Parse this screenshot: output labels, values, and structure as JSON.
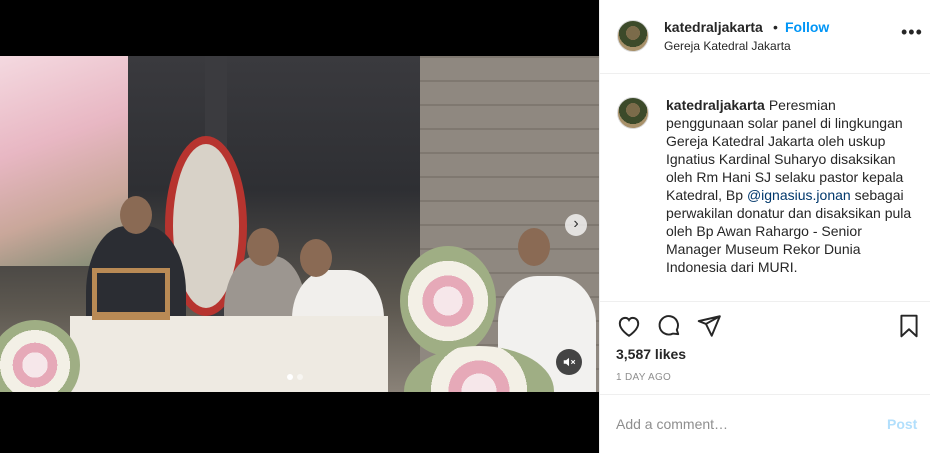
{
  "post": {
    "username": "katedraljakarta",
    "follow_label": "Follow",
    "separator": "•",
    "location": "Gereja Katedral Jakarta",
    "more_label": "•••"
  },
  "caption": {
    "username": "katedraljakarta",
    "text_before": "Peresmian penggunaan solar panel di lingkungan Gereja Katedral Jakarta oleh uskup Ignatius Kardinal Suharyo disaksikan oleh Rm Hani SJ selaku pastor kepala Katedral, Bp",
    "mention": "@ignasius.jonan",
    "text_after": "sebagai perwakilan donatur dan disaksikan pula oleh Bp Awan Rahargo - Senior Manager Museum Rekor Dunia Indonesia dari MURI."
  },
  "stats": {
    "likes": "3,587 likes",
    "time": "1 DAY AGO"
  },
  "comment": {
    "placeholder": "Add a comment…",
    "post_label": "Post"
  },
  "media": {
    "next_arrow": "›",
    "carousel_total": 2,
    "carousel_active": 1
  },
  "icons": {
    "like": "heart-icon",
    "comment": "comment-icon",
    "share": "share-icon",
    "save": "bookmark-icon",
    "mute": "speaker-muted-icon",
    "more": "more-options-icon",
    "next": "chevron-right-icon"
  },
  "colors": {
    "link_blue": "#0095f6",
    "mention": "#00376b",
    "post_disabled": "#b2dffc",
    "meta_gray": "#8e8e8e"
  }
}
